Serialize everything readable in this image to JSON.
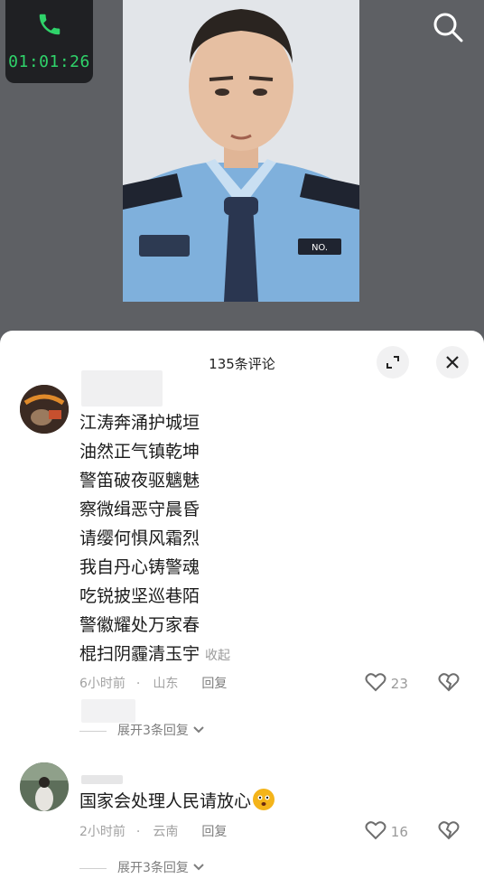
{
  "call": {
    "timer": "01:01:26"
  },
  "icons": {
    "phone": "phone-icon",
    "search": "search-icon",
    "expand": "expand-icon",
    "close": "close-icon",
    "heart": "heart-icon",
    "dislike": "broken-heart-icon",
    "chevron": "chevron-down-icon"
  },
  "colors": {
    "call_green": "#2fd36a",
    "sheet_bg": "#ffffff",
    "backdrop": "#5e6064"
  },
  "comments_header": {
    "title": "135条评论"
  },
  "comment1": {
    "lines": [
      "江涛奔涌护城垣",
      "油然正气镇乾坤",
      "警笛破夜驱魑魅",
      "察微缉恶守晨昏",
      "请缨何惧风霜烈",
      "我自丹心铸警魂",
      "吃锐披坚巡巷陌",
      "警徽耀处万家春",
      "棍扫阴霾清玉宇"
    ],
    "fold_label": "收起",
    "time": "6小时前",
    "location": "山东",
    "reply_label": "回复",
    "likes": "23",
    "expand_label": "展开3条回复"
  },
  "comment2": {
    "text": "国家会处理人民请放心",
    "time": "2小时前",
    "location": "云南",
    "reply_label": "回复",
    "likes": "16",
    "expand_label": "展开3条回复"
  }
}
